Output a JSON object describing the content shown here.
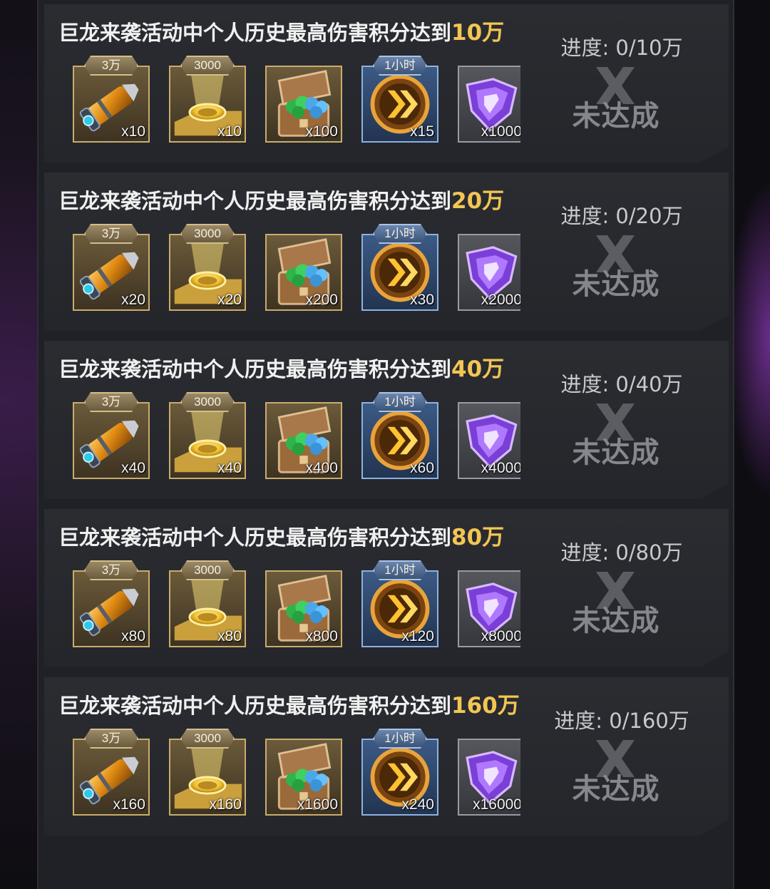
{
  "cards": [
    {
      "title_prefix": "巨龙来袭活动中个人历史最高伤害积分达到",
      "title_amount": "10万",
      "progress": "进度: 0/10万",
      "status": "未达成",
      "rewards": [
        {
          "icon": "shell-icon",
          "tag": "3万",
          "count": "x10"
        },
        {
          "icon": "gold-plate-icon",
          "tag": "3000",
          "count": "x10"
        },
        {
          "icon": "gem-chest-icon",
          "tag": "",
          "count": "x100"
        },
        {
          "icon": "speedup-icon",
          "tag": "1小时",
          "count": "x15"
        },
        {
          "icon": "purple-crystal-icon",
          "tag": "",
          "count": "x1000"
        }
      ]
    },
    {
      "title_prefix": "巨龙来袭活动中个人历史最高伤害积分达到",
      "title_amount": "20万",
      "progress": "进度: 0/20万",
      "status": "未达成",
      "rewards": [
        {
          "icon": "shell-icon",
          "tag": "3万",
          "count": "x20"
        },
        {
          "icon": "gold-plate-icon",
          "tag": "3000",
          "count": "x20"
        },
        {
          "icon": "gem-chest-icon",
          "tag": "",
          "count": "x200"
        },
        {
          "icon": "speedup-icon",
          "tag": "1小时",
          "count": "x30"
        },
        {
          "icon": "purple-crystal-icon",
          "tag": "",
          "count": "x2000"
        }
      ]
    },
    {
      "title_prefix": "巨龙来袭活动中个人历史最高伤害积分达到",
      "title_amount": "40万",
      "progress": "进度: 0/40万",
      "status": "未达成",
      "rewards": [
        {
          "icon": "shell-icon",
          "tag": "3万",
          "count": "x40"
        },
        {
          "icon": "gold-plate-icon",
          "tag": "3000",
          "count": "x40"
        },
        {
          "icon": "gem-chest-icon",
          "tag": "",
          "count": "x400"
        },
        {
          "icon": "speedup-icon",
          "tag": "1小时",
          "count": "x60"
        },
        {
          "icon": "purple-crystal-icon",
          "tag": "",
          "count": "x4000"
        }
      ]
    },
    {
      "title_prefix": "巨龙来袭活动中个人历史最高伤害积分达到",
      "title_amount": "80万",
      "progress": "进度: 0/80万",
      "status": "未达成",
      "rewards": [
        {
          "icon": "shell-icon",
          "tag": "3万",
          "count": "x80"
        },
        {
          "icon": "gold-plate-icon",
          "tag": "3000",
          "count": "x80"
        },
        {
          "icon": "gem-chest-icon",
          "tag": "",
          "count": "x800"
        },
        {
          "icon": "speedup-icon",
          "tag": "1小时",
          "count": "x120"
        },
        {
          "icon": "purple-crystal-icon",
          "tag": "",
          "count": "x8000"
        }
      ]
    },
    {
      "title_prefix": "巨龙来袭活动中个人历史最高伤害积分达到",
      "title_amount": "160万",
      "progress": "进度: 0/160万",
      "status": "未达成",
      "rewards": [
        {
          "icon": "shell-icon",
          "tag": "3万",
          "count": "x160"
        },
        {
          "icon": "gold-plate-icon",
          "tag": "3000",
          "count": "x160"
        },
        {
          "icon": "gem-chest-icon",
          "tag": "",
          "count": "x1600"
        },
        {
          "icon": "speedup-icon",
          "tag": "1小时",
          "count": "x240"
        },
        {
          "icon": "purple-crystal-icon",
          "tag": "",
          "count": "x16000"
        }
      ]
    }
  ],
  "colors": {
    "amount": "#f3c653",
    "title": "#f0f0f0",
    "status": "#85878d"
  }
}
